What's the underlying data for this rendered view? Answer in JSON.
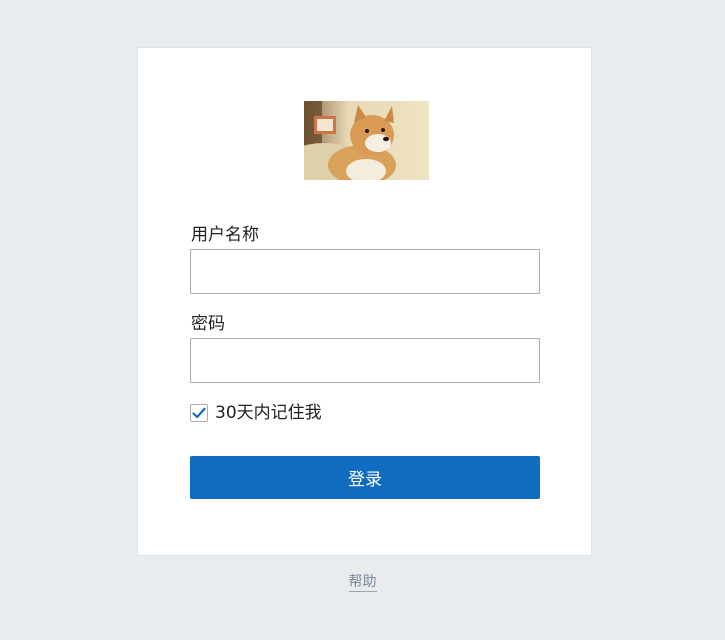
{
  "login": {
    "logo_icon": "shiba-dog-photo-icon",
    "username_label": "用户名称",
    "username_value": "",
    "password_label": "密码",
    "password_value": "",
    "remember_checked": true,
    "remember_label": "30天内记住我",
    "submit_label": "登录"
  },
  "footer": {
    "help_label": "帮助"
  },
  "colors": {
    "background": "#e9ecef",
    "card": "#ffffff",
    "primary_button": "#0f6cbf",
    "checkmark": "#0f6cbf",
    "help_link": "#7b8a9a"
  }
}
